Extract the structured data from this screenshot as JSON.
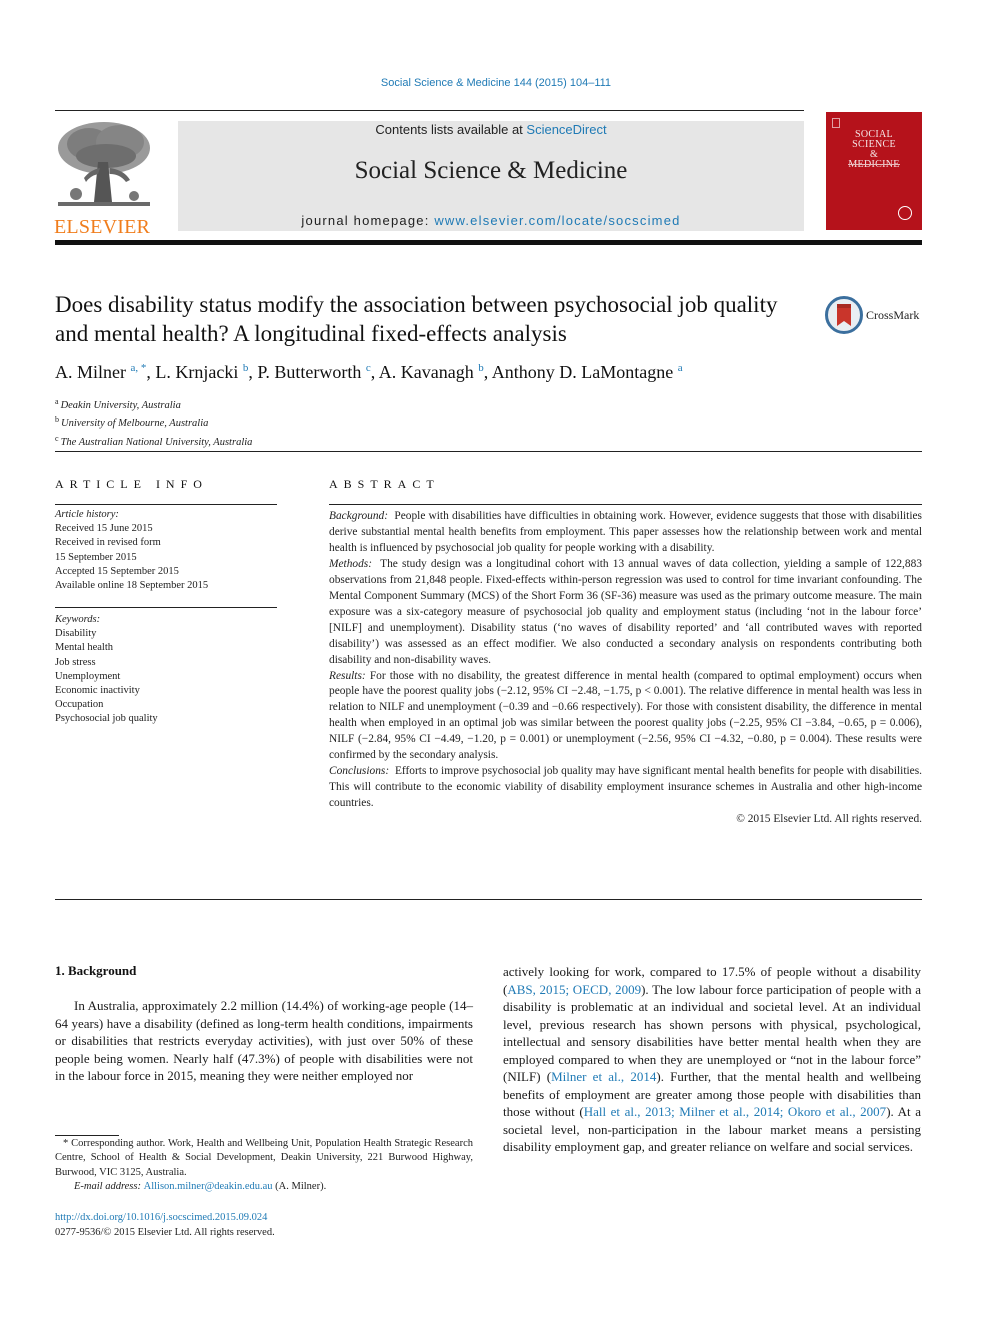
{
  "journal": {
    "citation": "Social Science & Medicine 144 (2015) 104–111",
    "contents_prefix": "Contents lists available at ",
    "contents_link": "ScienceDirect",
    "title": "Social Science & Medicine",
    "homepage_prefix": "journal homepage: ",
    "homepage_link": "www.elsevier.com/locate/socscimed",
    "publisher_logo_text": "ELSEVIER",
    "cover_title_lines": [
      "SOCIAL",
      "SCIENCE",
      "&",
      "MEDICINE"
    ],
    "colors": {
      "link": "#1f7ab5",
      "elsevier_orange": "#f07d1c",
      "cover_red": "#b5121b",
      "banner_gray": "#e6e6e6"
    }
  },
  "article": {
    "title": "Does disability status modify the association between psychosocial job quality and mental health? A longitudinal fixed-effects analysis",
    "crossmark_label": "CrossMark",
    "authors": [
      {
        "name": "A. Milner",
        "sup": "a, *"
      },
      {
        "name": "L. Krnjacki",
        "sup": "b"
      },
      {
        "name": "P. Butterworth",
        "sup": "c"
      },
      {
        "name": "A. Kavanagh",
        "sup": "b"
      },
      {
        "name": "Anthony D. LaMontagne",
        "sup": "a"
      }
    ],
    "affiliations": [
      {
        "mark": "a",
        "text": "Deakin University, Australia"
      },
      {
        "mark": "b",
        "text": "University of Melbourne, Australia"
      },
      {
        "mark": "c",
        "text": "The Australian National University, Australia"
      }
    ]
  },
  "article_info": {
    "heading": "ARTICLE INFO",
    "history_label": "Article history:",
    "history": [
      "Received 15 June 2015",
      "Received in revised form",
      "15 September 2015",
      "Accepted 15 September 2015",
      "Available online 18 September 2015"
    ],
    "keywords_label": "Keywords:",
    "keywords": [
      "Disability",
      "Mental health",
      "Job stress",
      "Unemployment",
      "Economic inactivity",
      "Occupation",
      "Psychosocial job quality"
    ]
  },
  "abstract": {
    "heading": "ABSTRACT",
    "sections": [
      {
        "label": "Background:",
        "text": "People with disabilities have difficulties in obtaining work. However, evidence suggests that those with disabilities derive substantial mental health benefits from employment. This paper assesses how the relationship between work and mental health is influenced by psychosocial job quality for people working with a disability."
      },
      {
        "label": "Methods:",
        "text": "The study design was a longitudinal cohort with 13 annual waves of data collection, yielding a sample of 122,883 observations from 21,848 people. Fixed-effects within-person regression was used to control for time invariant confounding. The Mental Component Summary (MCS) of the Short Form 36 (SF-36) measure was used as the primary outcome measure. The main exposure was a six-category measure of psychosocial job quality and employment status (including ‘not in the labour force’ [NILF] and unemployment). Disability status (‘no waves of disability reported’ and ‘all contributed waves with reported disability’) was assessed as an effect modifier. We also conducted a secondary analysis on respondents contributing both disability and non-disability waves."
      },
      {
        "label": "Results:",
        "text": "For those with no disability, the greatest difference in mental health (compared to optimal employment) occurs when people have the poorest quality jobs (−2.12, 95% CI −2.48, −1.75, p < 0.001). The relative difference in mental health was less in relation to NILF and unemployment (−0.39 and −0.66 respectively). For those with consistent disability, the difference in mental health when employed in an optimal job was similar between the poorest quality jobs (−2.25, 95% CI −3.84, −0.65, p = 0.006), NILF (−2.84, 95% CI −4.49, −1.20, p = 0.001) or unemployment (−2.56, 95% CI −4.32, −0.80, p = 0.004). These results were confirmed by the secondary analysis."
      },
      {
        "label": "Conclusions:",
        "text": "Efforts to improve psychosocial job quality may have significant mental health benefits for people with disabilities. This will contribute to the economic viability of disability employment insurance schemes in Australia and other high-income countries."
      }
    ],
    "copyright": "© 2015 Elsevier Ltd. All rights reserved."
  },
  "body": {
    "section_heading": "1.  Background",
    "left_paragraph": "In Australia, approximately 2.2 million (14.4%) of working-age people (14–64 years) have a disability (defined as long-term health conditions, impairments or disabilities that restricts everyday activities), with just over 50% of these people being women. Nearly half (47.3%) of people with disabilities were not in the labour force in 2015, meaning they were neither employed nor",
    "right_paragraph": {
      "p1": "actively looking for work, compared to 17.5% of people without a disability (",
      "ref1": "ABS, 2015; OECD, 2009",
      "p2": "). The low labour force participation of people with a disability is problematic at an individual and societal level. At an individual level, previous research has shown persons with physical, psychological, intellectual and sensory disabilities have better mental health when they are employed compared to when they are unemployed or “not in the labour force” (NILF) (",
      "ref2": "Milner et al., 2014",
      "p3": "). Further, that the mental health and wellbeing benefits of employment are greater among those people with disabilities than those without (",
      "ref3": "Hall et al., 2013; Milner et al., 2014; Okoro et al., 2007",
      "p4": "). At a societal level, non-participation in the labour market means a persisting disability employment gap, and greater reliance on welfare and social services."
    }
  },
  "footnote": {
    "corresponding": "* Corresponding author. Work, Health and Wellbeing Unit, Population Health Strategic Research Centre, School of Health & Social Development, Deakin University, 221 Burwood Highway, Burwood, VIC 3125, Australia.",
    "email_label": "E-mail address: ",
    "email": "Allison.milner@deakin.edu.au",
    "email_suffix": " (A. Milner).",
    "doi": "http://dx.doi.org/10.1016/j.socscimed.2015.09.024",
    "issn_copyright": "0277-9536/© 2015 Elsevier Ltd. All rights reserved."
  }
}
